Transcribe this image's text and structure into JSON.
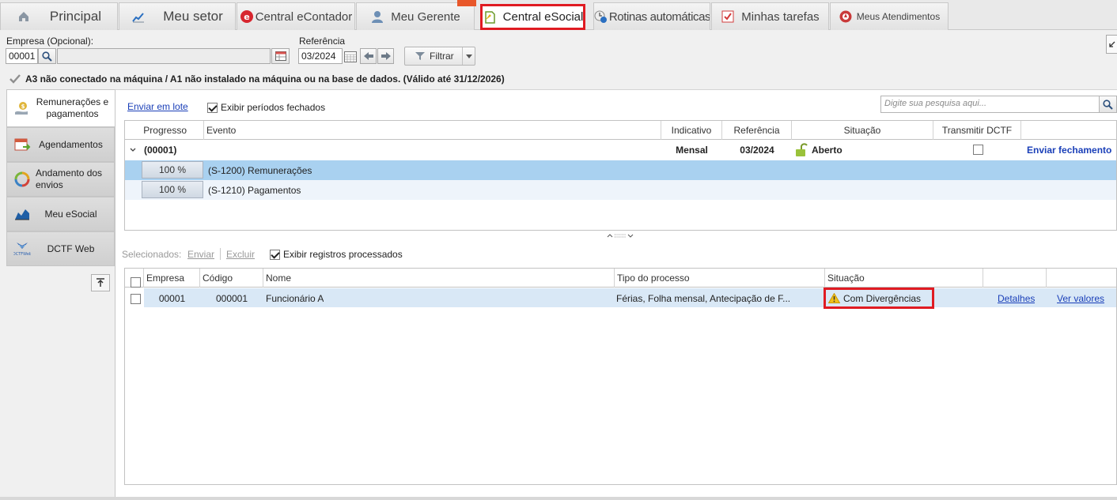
{
  "tabs": [
    {
      "label": "Principal",
      "icon": "home-icon"
    },
    {
      "label": "Meu setor",
      "icon": "chart-icon"
    },
    {
      "label": "Central eContador",
      "icon": "econtador-logo-icon"
    },
    {
      "label": "Meu Gerente",
      "icon": "person-icon"
    },
    {
      "label": "Central eSocial",
      "icon": "esocial-doc-icon"
    },
    {
      "label": "Rotinas automáticas",
      "icon": "clock-gear-icon"
    },
    {
      "label": "Minhas tarefas",
      "icon": "checklist-icon"
    },
    {
      "label": "Meus Atendimentos",
      "icon": "support-icon"
    }
  ],
  "filters": {
    "empresa_label": "Empresa (Opcional):",
    "empresa_code": "00001",
    "empresa_name": "",
    "referencia_label": "Referência",
    "referencia_value": "03/2024",
    "filter_button": "Filtrar"
  },
  "cert_notice": "A3 não conectado na máquina / A1 não instalado na máquina ou na base de dados. (Válido até 31/12/2026)",
  "nav": [
    {
      "label": "Remunerações e pagamentos",
      "icon": "money-hand-icon"
    },
    {
      "label": "Agendamentos",
      "icon": "calendar-arrow-icon"
    },
    {
      "label": "Andamento dos envios",
      "icon": "sync-icon"
    },
    {
      "label": "Meu eSocial",
      "icon": "area-chart-icon"
    },
    {
      "label": "DCTF Web",
      "icon": "dctfweb-icon"
    }
  ],
  "top_toolbar": {
    "send_batch": "Enviar em lote",
    "show_closed": "Exibir períodos fechados",
    "search_placeholder": "Digite sua pesquisa aqui..."
  },
  "grid1": {
    "headers": [
      "Progresso",
      "Evento",
      "Indicativo",
      "Referência",
      "Situação",
      "Transmitir DCTF"
    ],
    "group": {
      "label": "(00001)",
      "indicativo": "Mensal",
      "referencia": "03/2024",
      "situacao": "Aberto",
      "action": "Enviar fechamento"
    },
    "rows": [
      {
        "progress": "100 %",
        "evento": "(S-1200) Remunerações"
      },
      {
        "progress": "100 %",
        "evento": "(S-1210) Pagamentos"
      }
    ]
  },
  "bottom_toolbar": {
    "selected": "Selecionados:",
    "send": "Enviar",
    "delete": "Excluir",
    "show_processed": "Exibir registros processados"
  },
  "grid2": {
    "headers": [
      "Empresa",
      "Código",
      "Nome",
      "Tipo do processo",
      "Situação"
    ],
    "rows": [
      {
        "empresa": "00001",
        "codigo": "000001",
        "nome": "Funcionário A",
        "tipo": "Férias, Folha mensal, Antecipação de F...",
        "situacao": "Com Divergências",
        "details": "Detalhes",
        "values": "Ver valores"
      }
    ]
  },
  "colors": {
    "highlight": "#e01b22",
    "selected_row": "#a9d1f0",
    "row_alt": "#eef4fb",
    "link": "#1a3fb8"
  }
}
